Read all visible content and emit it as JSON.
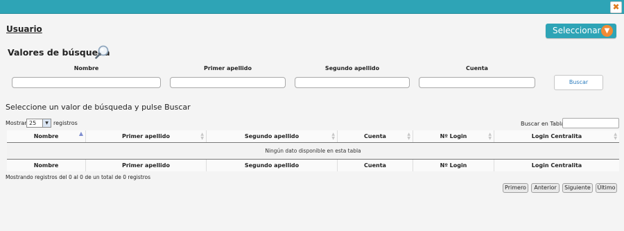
{
  "dialog": {
    "close_symbol": "✖"
  },
  "header": {
    "title": "Usuario",
    "select_button": "Seleccionar",
    "select_icon": "arrow-down-icon"
  },
  "search": {
    "title": "Valores de búsqueda",
    "fields": [
      {
        "label": "Nombre",
        "value": ""
      },
      {
        "label": "Primer apellido",
        "value": ""
      },
      {
        "label": "Segundo apellido",
        "value": ""
      },
      {
        "label": "Cuenta",
        "value": ""
      }
    ],
    "button": "Buscar"
  },
  "instructions": "Seleccione un valor de búsqueda y pulse Buscar",
  "table_controls": {
    "show_label": "Mostrar",
    "page_size": "25",
    "records_label": "registros",
    "search_label": "Buscar en Tabla:",
    "search_value": ""
  },
  "table": {
    "columns": [
      "Nombre",
      "Primer apellido",
      "Segundo apellido",
      "Cuenta",
      "Nº Login",
      "Login Centralita"
    ],
    "empty_message": "Ningún dato disponible en esta tabla"
  },
  "info": "Mostrando registros del 0 al 0 de un total de 0 registros",
  "pagination": {
    "first": "Primero",
    "previous": "Anterior",
    "next": "Siguiente",
    "last": "Último"
  },
  "colors": {
    "accent": "#2ea4b6",
    "orange": "#f08a34"
  }
}
